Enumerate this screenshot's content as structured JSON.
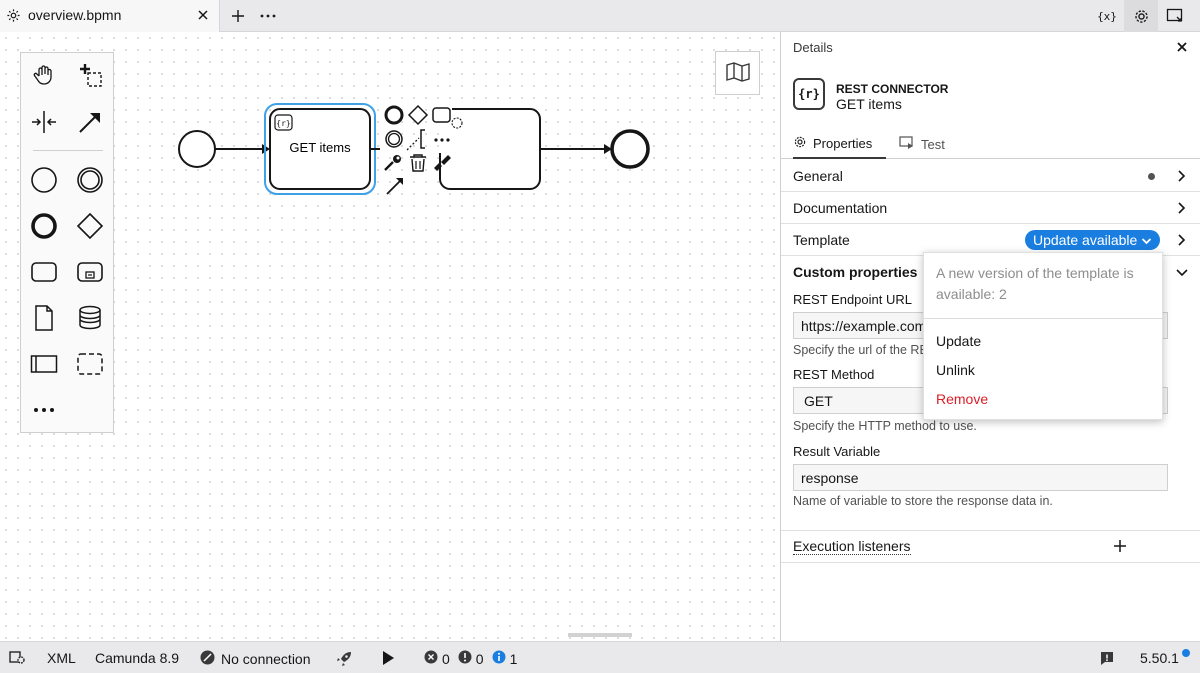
{
  "tab": {
    "title": "overview.bpmn"
  },
  "diagram": {
    "task_label": "GET items"
  },
  "panel": {
    "title": "Details",
    "element_icon": "{r}",
    "element_type": "REST CONNECTOR",
    "element_name": "GET items",
    "tabs": [
      {
        "label": "Properties"
      },
      {
        "label": "Test"
      }
    ],
    "groups": {
      "general": "General",
      "documentation": "Documentation",
      "template": "Template",
      "custom": "Custom properties"
    },
    "template_badge": "Update available",
    "fields": [
      {
        "label": "REST Endpoint URL",
        "value": "https://example.com",
        "description": "Specify the url of the REST API."
      },
      {
        "label": "REST Method",
        "value": "GET",
        "description": "Specify the HTTP method to use."
      },
      {
        "label": "Result Variable",
        "value": "response",
        "description": "Name of variable to store the response data in."
      }
    ],
    "execution_listeners": "Execution listeners"
  },
  "popup": {
    "message": "A new version of the template is available: 2",
    "items": [
      {
        "label": "Update"
      },
      {
        "label": "Unlink"
      },
      {
        "label": "Remove"
      }
    ]
  },
  "status": {
    "format": "XML",
    "engine": "Camunda 8.9",
    "connection": "No connection",
    "errors": "0",
    "warnings": "0",
    "infos": "1",
    "version": "5.50.1"
  },
  "colors": {
    "accent": "#1a7ee0",
    "selection": "#3fa0e6",
    "danger": "#da1e28"
  }
}
